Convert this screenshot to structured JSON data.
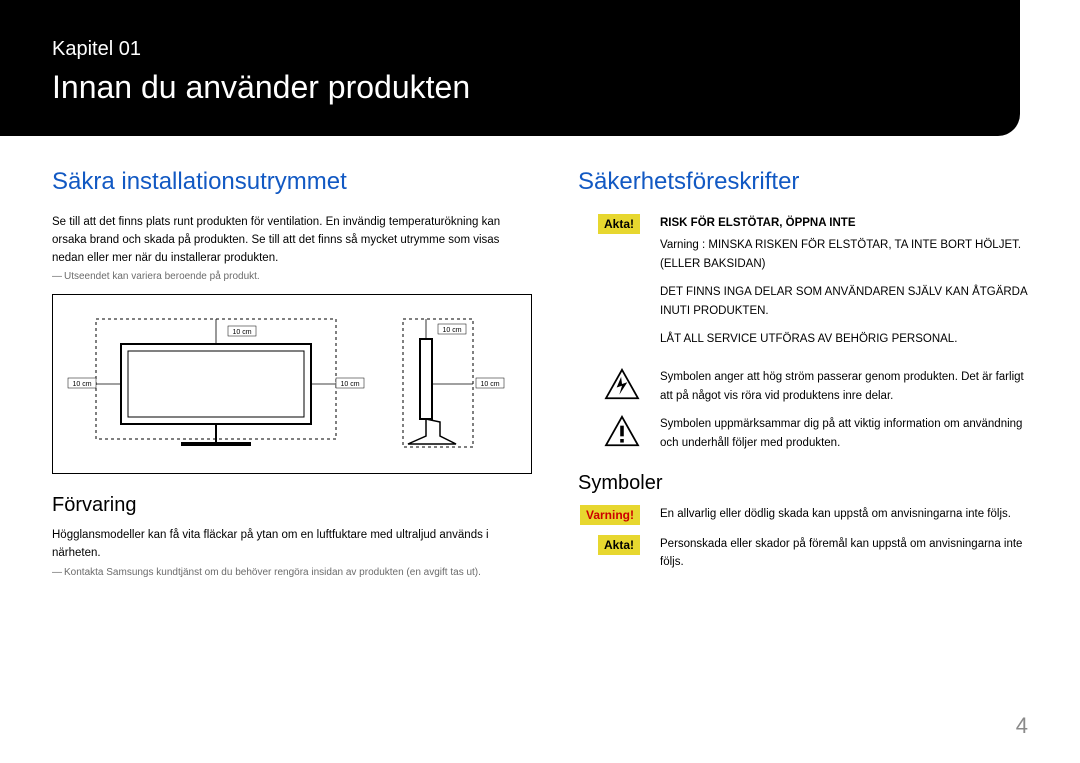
{
  "header": {
    "chapter": "Kapitel 01",
    "title": "Innan du använder produkten"
  },
  "left": {
    "h2": "Säkra installationsutrymmet",
    "para": "Se till att det finns plats runt produkten för ventilation. En invändig temperaturökning kan orsaka brand och skada på produkten. Se till att det finns så mycket utrymme som visas nedan eller mer när du installerar produkten.",
    "foot1": "Utseendet kan variera beroende på produkt.",
    "diagram_labels": {
      "dist": "10 cm"
    },
    "storage_h3": "Förvaring",
    "storage_p": "Högglansmodeller kan få vita fläckar på ytan om en luftfuktare med ultraljud används i närheten.",
    "storage_foot": "Kontakta Samsungs kundtjänst om du behöver rengöra insidan av produkten (en avgift tas ut)."
  },
  "right": {
    "h2": "Säkerhetsföreskrifter",
    "caution_label": "Akta!",
    "risk_heading": "RISK FÖR ELSTÖTAR, ÖPPNA INTE",
    "risk_p1": "Varning : MINSKA RISKEN FÖR ELSTÖTAR, TA INTE BORT HÖLJET. (ELLER BAKSIDAN)",
    "risk_p2": "DET FINNS INGA DELAR SOM ANVÄNDAREN SJÄLV KAN ÅTGÄRDA INUTI PRODUKTEN.",
    "risk_p3": "LÅT ALL SERVICE UTFÖRAS AV BEHÖRIG PERSONAL.",
    "sym_volt": "Symbolen anger att hög ström passerar genom produkten. Det är farligt att på något vis röra vid produktens inre delar.",
    "sym_excl": "Symbolen uppmärksammar dig på att viktig information om användning och underhåll följer med produkten.",
    "symbols_h3": "Symboler",
    "warning_label": "Varning!",
    "warning_text": "En allvarlig eller dödlig skada kan uppstå om anvisningarna inte följs.",
    "caution_label2": "Akta!",
    "caution_text": "Personskada eller skador på föremål kan uppstå om anvisningarna inte följs."
  },
  "page_number": "4"
}
